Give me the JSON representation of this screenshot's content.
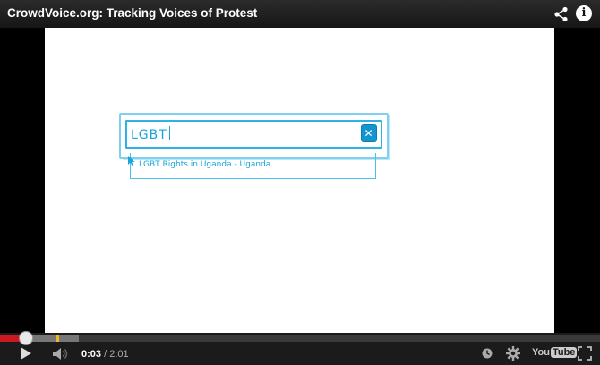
{
  "window": {
    "title": "CrowdVoice.org: Tracking Voices of Protest"
  },
  "header": {
    "share_icon": "share-icon",
    "info_icon": "info-icon",
    "info_glyph": "i"
  },
  "video": {
    "search_text": "LGBT",
    "clear_glyph": "✕",
    "suggestion": "LGBT Rights in Uganda - Uganda"
  },
  "player": {
    "current_time": "0:03",
    "separator": " / ",
    "duration": "2:01",
    "progress_fraction": 0.025,
    "buffered_fraction": 0.066,
    "logo_you": "You",
    "logo_tube": "Tube",
    "accent_color": "#cc181e"
  }
}
